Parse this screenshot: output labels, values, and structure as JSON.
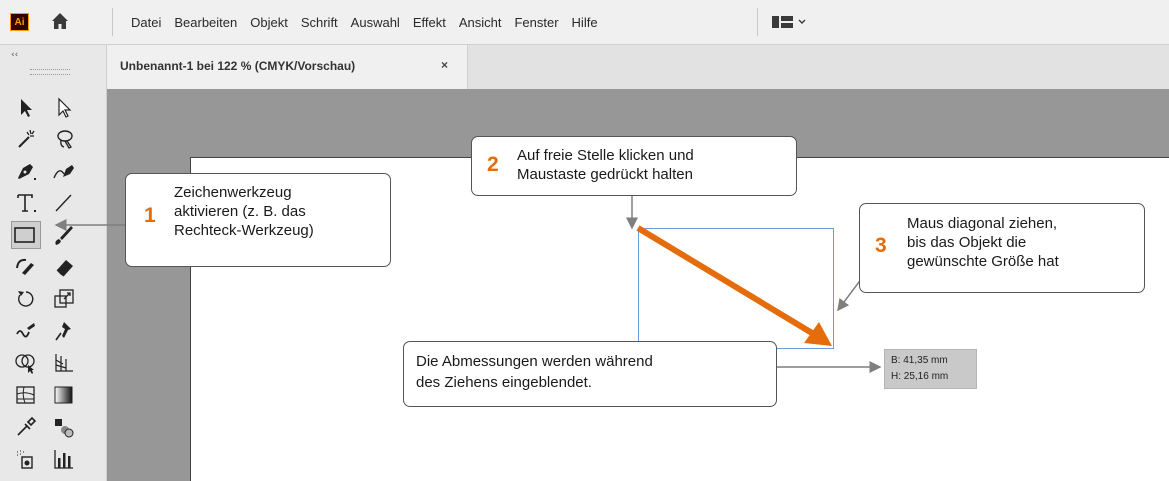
{
  "app": {
    "logo_text": "Ai"
  },
  "menu": {
    "items": [
      "Datei",
      "Bearbeiten",
      "Objekt",
      "Schrift",
      "Auswahl",
      "Effekt",
      "Ansicht",
      "Fenster",
      "Hilfe"
    ]
  },
  "document_tab": {
    "title": "Unbenannt-1 bei 122 % (CMYK/Vorschau)",
    "close": "×"
  },
  "toolbar": {
    "collapse": "‹‹"
  },
  "callouts": {
    "c1": {
      "number": "1",
      "lines": [
        "Zeichenwerkzeug",
        "aktivieren (z. B. das",
        "Rechteck-Werkzeug)"
      ]
    },
    "c2": {
      "number": "2",
      "lines": [
        "Auf freie Stelle klicken und",
        "Maustaste gedrückt halten"
      ]
    },
    "c3": {
      "number": "3",
      "lines": [
        "Maus diagonal ziehen,",
        "bis das Objekt die",
        "gewünschte Größe hat"
      ]
    },
    "c4": {
      "lines": [
        "Die Abmessungen werden während",
        "des Ziehens eingeblendet."
      ]
    }
  },
  "measure": {
    "width": "B: 41,35 mm",
    "height": "H: 25,16 mm"
  },
  "colors": {
    "accent": "#e46c0a",
    "selection": "#6d9de0",
    "artboard": "#ffffff",
    "canvas": "#979797"
  },
  "tools": [
    "selection-tool",
    "direct-selection-tool",
    "magic-wand-tool",
    "lasso-tool",
    "pen-tool",
    "curvature-tool",
    "type-tool",
    "line-tool",
    "rectangle-tool",
    "paintbrush-tool",
    "shaper-tool",
    "eraser-tool",
    "rotate-tool",
    "scale-tool",
    "warp-tool",
    "puppet-warp-tool",
    "shape-builder-tool",
    "perspective-grid-tool",
    "mesh-tool",
    "gradient-tool",
    "eyedropper-tool",
    "blend-tool",
    "symbol-sprayer-tool",
    "graph-tool"
  ]
}
